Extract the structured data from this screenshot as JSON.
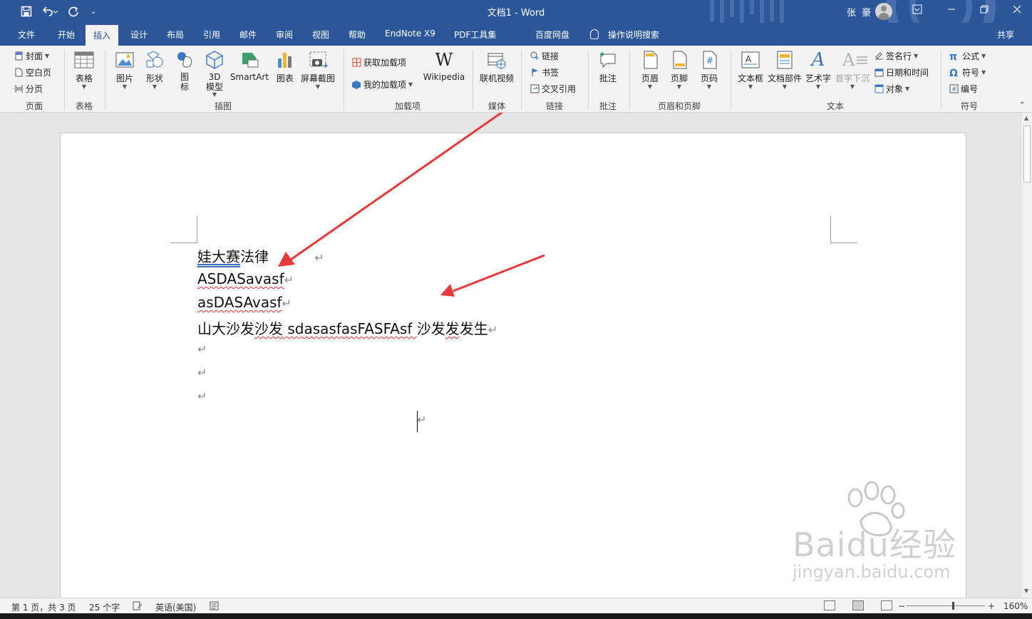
{
  "window": {
    "title": "文档1 - Word",
    "user": "张 豪",
    "quick_access": [
      "save-icon",
      "undo-icon",
      "redo-icon",
      "customize-icon"
    ],
    "controls": [
      "ribbon-display-icon",
      "minimize-icon",
      "restore-icon",
      "close-icon"
    ]
  },
  "tabs": [
    {
      "label": "文件"
    },
    {
      "label": "开始"
    },
    {
      "label": "插入"
    },
    {
      "label": "设计"
    },
    {
      "label": "布局"
    },
    {
      "label": "引用"
    },
    {
      "label": "邮件"
    },
    {
      "label": "审阅"
    },
    {
      "label": "视图"
    },
    {
      "label": "帮助"
    },
    {
      "label": "EndNote X9"
    },
    {
      "label": "PDF工具集"
    },
    {
      "label": "百度网盘"
    },
    {
      "label": "操作说明搜索"
    }
  ],
  "share_label": "共享",
  "ribbon": {
    "pages": {
      "label": "页面",
      "cover": "封面",
      "blank": "空白页",
      "break": "分页"
    },
    "tables": {
      "label": "表格",
      "table": "表格"
    },
    "illustrations": {
      "label": "插图",
      "pictures": "图片",
      "shapes": "形状",
      "icons": "图\n标",
      "models": "3D\n模型",
      "smartart": "SmartArt",
      "chart": "图表",
      "screenshot": "屏幕截图"
    },
    "addins": {
      "label": "加载项",
      "get": "获取加载项",
      "my": "我的加载项",
      "wiki": "Wikipedia"
    },
    "media": {
      "label": "媒体",
      "video": "联机视频"
    },
    "links": {
      "label": "链接",
      "link": "链接",
      "bookmark": "书签",
      "crossref": "交叉引用"
    },
    "comments": {
      "label": "批注",
      "comment": "批注"
    },
    "headerfooter": {
      "label": "页眉和页脚",
      "header": "页眉",
      "footer": "页脚",
      "pagenum": "页码"
    },
    "text": {
      "label": "文本",
      "textbox": "文本框",
      "parts": "文档部件",
      "wordart": "艺术字",
      "dropcap": "首字下沉",
      "sigline": "签名行",
      "datetime": "日期和时间",
      "object": "对象"
    },
    "symbols": {
      "label": "符号",
      "equation": "公式",
      "symbol": "符号",
      "number": "编号"
    }
  },
  "document": {
    "lines": {
      "l1a": "娃大赛",
      "l1b": "法律",
      "l2": "ASDASavasf",
      "l3": "asDASAvasf",
      "l4a": "山大沙发",
      "l4b": "沙发",
      "l4c": " sdasasfasFASFAsf ",
      "l4d": "沙发",
      "l4e": "发",
      "l4f": "发生"
    },
    "para_mark": "↵"
  },
  "status": {
    "page": "第 1 页，共 3 页",
    "words": "25 个字",
    "language": "英语(美国)",
    "zoom": "160%"
  },
  "watermark": {
    "brand": "Baidu经验",
    "url": "jingyan.baidu.com"
  },
  "colors": {
    "accent": "#2b579a",
    "arrow": "#e8393b"
  }
}
